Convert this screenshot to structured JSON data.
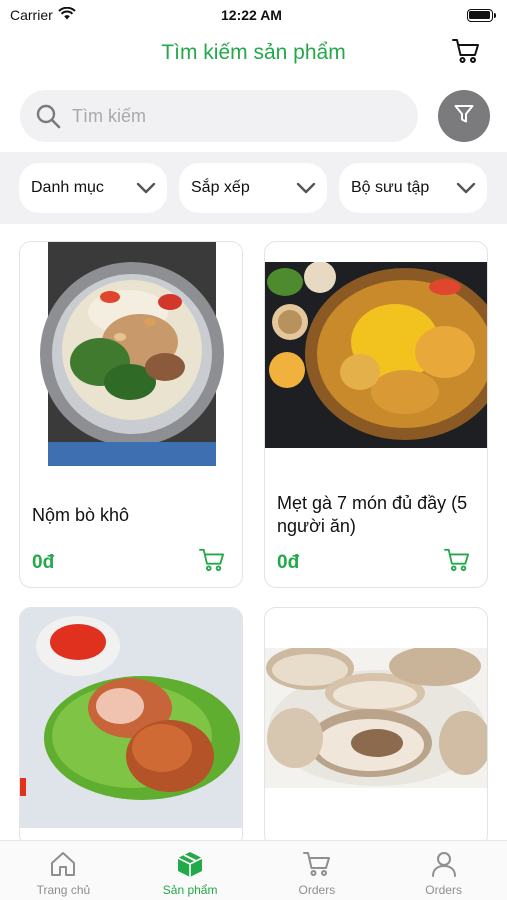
{
  "status_bar": {
    "carrier": "Carrier",
    "time": "12:22 AM"
  },
  "header": {
    "title": "Tìm kiếm sản phẩm",
    "cart_icon": "cart-icon"
  },
  "search": {
    "placeholder": "Tìm kiếm",
    "value": ""
  },
  "filters": [
    {
      "label": "Danh mục"
    },
    {
      "label": "Sắp xếp"
    },
    {
      "label": "Bộ sưu tập"
    }
  ],
  "products": [
    {
      "name": "Nộm bò khô",
      "price": "0đ"
    },
    {
      "name": "Mẹt gà 7 món đủ đầy (5 người ăn)",
      "price": "0đ"
    },
    {
      "name": "",
      "price": ""
    },
    {
      "name": "",
      "price": ""
    }
  ],
  "tabs": [
    {
      "label": "Trang chủ",
      "icon": "home-icon",
      "active": false
    },
    {
      "label": "Sản phẩm",
      "icon": "box-icon",
      "active": true
    },
    {
      "label": "Orders",
      "icon": "cart-icon",
      "active": false
    },
    {
      "label": "Orders",
      "icon": "user-icon",
      "active": false
    }
  ],
  "colors": {
    "accent": "#23a84a",
    "filter_button": "#7b7b7d",
    "surface": "#f1f1f3"
  }
}
